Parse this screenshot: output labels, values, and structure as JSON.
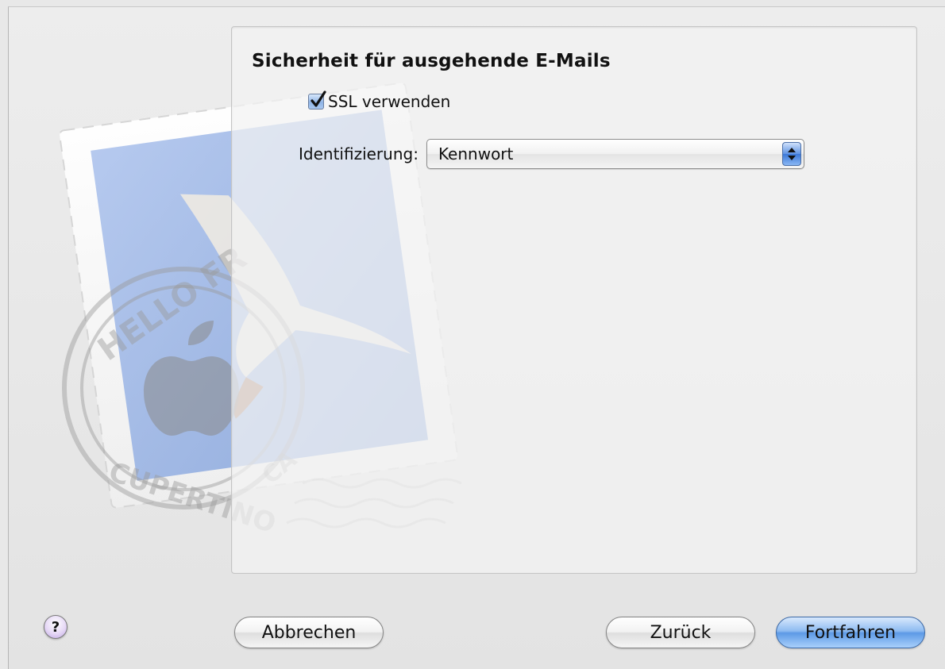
{
  "panel": {
    "title": "Sicherheit für ausgehende E-Mails",
    "ssl_checkbox": {
      "label": "SSL verwenden",
      "checked": true
    },
    "authentication": {
      "label": "Identifizierung:",
      "selected": "Kennwort"
    }
  },
  "stamp": {
    "text_top": "HELLO FR",
    "text_bottom": "CUPERTINO",
    "text_state": "CA"
  },
  "footer": {
    "help_label": "?",
    "cancel_label": "Abbrechen",
    "back_label": "Zurück",
    "continue_label": "Fortfahren"
  },
  "colors": {
    "accent": "#5d9ae6",
    "stamp_blue": "#9db6e6",
    "help_purple": "#bfa6e3"
  },
  "icons": {
    "checkbox": "checkmark-icon",
    "popup": "up-down-arrows-icon",
    "help": "question-icon",
    "logo": "mail-stamp-icon"
  }
}
